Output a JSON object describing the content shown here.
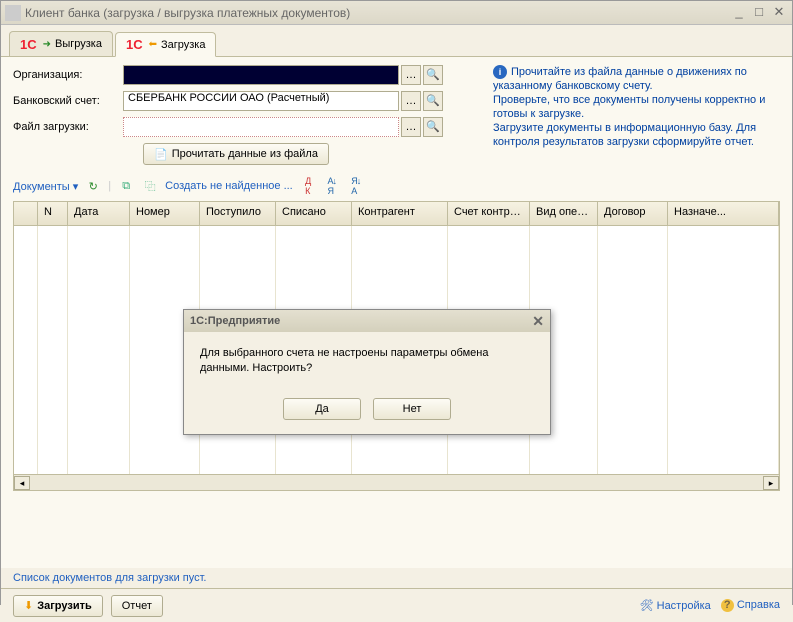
{
  "window": {
    "title": "Клиент банка (загрузка / выгрузка платежных документов)"
  },
  "tabs": {
    "export_label": "Выгрузка",
    "import_label": "Загрузка"
  },
  "form": {
    "org_label": "Организация:",
    "org_value": "",
    "account_label": "Банковский счет:",
    "account_value": "СБЕРБАНК РОССИИ ОАО (Расчетный)",
    "file_label": "Файл загрузки:",
    "file_value": "",
    "read_button": "Прочитать данные из файла"
  },
  "info": {
    "line1": "Прочитайте из файла данные о движениях по указанному банковскому счету.",
    "line2": "Проверьте, что все  документы получены корректно и готовы к загрузке.",
    "line3": "Загрузите документы в информационную базу. Для контроля результатов загрузки сформируйте отчет."
  },
  "toolbar": {
    "documents_label": "Документы",
    "create_missing_label": "Создать не найденное ..."
  },
  "grid": {
    "columns": [
      "",
      "N",
      "Дата",
      "Номер",
      "Поступило",
      "Списано",
      "Контрагент",
      "Счет контраг...",
      "Вид опер...",
      "Договор",
      "Назначе..."
    ],
    "widths": [
      24,
      30,
      62,
      70,
      76,
      76,
      96,
      82,
      68,
      70,
      80
    ]
  },
  "status": {
    "empty_text": "Список документов для загрузки пуст."
  },
  "footer": {
    "load_label": "Загрузить",
    "report_label": "Отчет",
    "settings_label": "Настройка",
    "help_label": "Справка"
  },
  "dialog": {
    "title": "1С:Предприятие",
    "message": "Для выбранного счета не настроены параметры обмена данными. Настроить?",
    "yes": "Да",
    "no": "Нет"
  }
}
